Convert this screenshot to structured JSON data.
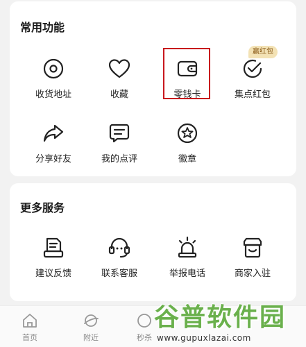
{
  "common": {
    "title": "常用功能",
    "items": [
      {
        "label": "收货地址",
        "icon": "location-pin-icon"
      },
      {
        "label": "收藏",
        "icon": "heart-icon"
      },
      {
        "label": "零钱卡",
        "icon": "wallet-icon"
      },
      {
        "label": "集点红包",
        "icon": "check-circle-icon",
        "badge": "赢红包"
      },
      {
        "label": "分享好友",
        "icon": "share-arrow-icon"
      },
      {
        "label": "我的点评",
        "icon": "comment-icon"
      },
      {
        "label": "徽章",
        "icon": "star-medal-icon"
      }
    ]
  },
  "more": {
    "title": "更多服务",
    "items": [
      {
        "label": "建议反馈",
        "icon": "feedback-icon"
      },
      {
        "label": "联系客服",
        "icon": "headset-icon"
      },
      {
        "label": "举报电话",
        "icon": "alarm-light-icon"
      },
      {
        "label": "商家入驻",
        "icon": "store-icon"
      }
    ]
  },
  "tabbar": {
    "tabs": [
      {
        "label": "首页",
        "icon": "home-icon"
      },
      {
        "label": "附近",
        "icon": "planet-icon"
      },
      {
        "label": "秒杀",
        "icon": "flash-icon"
      }
    ]
  },
  "watermark": {
    "title": "谷普软件园",
    "url": "www.gupuxlazai.com"
  },
  "colors": {
    "highlight": "#c8161d",
    "badge_bg": "#f3e2b5",
    "badge_text": "#8a5a17",
    "icon": "#222222"
  }
}
